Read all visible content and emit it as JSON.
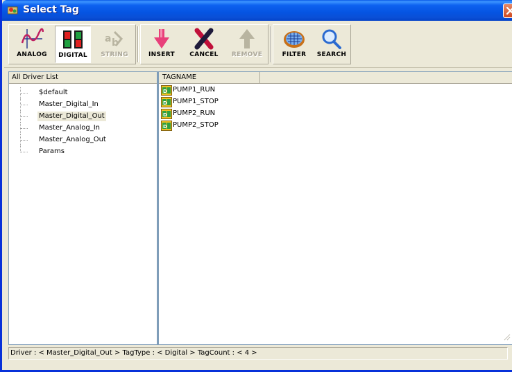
{
  "window": {
    "title": "Select Tag",
    "title_icon": "app-icon",
    "close_icon": "close-icon"
  },
  "toolbar": {
    "buttons": [
      {
        "label": "ANALOG",
        "icon": "analog-wave-icon",
        "state": "normal"
      },
      {
        "label": "DIGITAL",
        "icon": "digital-blocks-icon",
        "state": "active"
      },
      {
        "label": "STRING",
        "icon": "string-icon",
        "state": "disabled"
      },
      {
        "label": "INSERT",
        "icon": "insert-arrow-icon",
        "state": "normal"
      },
      {
        "label": "CANCEL",
        "icon": "cancel-x-icon",
        "state": "normal"
      },
      {
        "label": "REMOVE",
        "icon": "remove-arrow-icon",
        "state": "disabled"
      },
      {
        "label": "FILTER",
        "icon": "filter-icon",
        "state": "normal"
      },
      {
        "label": "SEARCH",
        "icon": "search-icon",
        "state": "normal"
      }
    ]
  },
  "driver_list": {
    "header": "All Driver List",
    "items": [
      {
        "label": "$default"
      },
      {
        "label": "Master_Digital_In"
      },
      {
        "label": "Master_Digital_Out",
        "selected": true
      },
      {
        "label": "Master_Analog_In"
      },
      {
        "label": "Master_Analog_Out"
      },
      {
        "label": "Params"
      }
    ]
  },
  "tag_list": {
    "column_header": "TAGNAME",
    "rows": [
      {
        "name": "PUMP1_RUN",
        "icon": "digital-tag-icon"
      },
      {
        "name": "PUMP1_STOP",
        "icon": "digital-tag-icon"
      },
      {
        "name": "PUMP2_RUN",
        "icon": "digital-tag-icon"
      },
      {
        "name": "PUMP2_STOP",
        "icon": "digital-tag-icon"
      }
    ]
  },
  "status": {
    "text": "Driver : < Master_Digital_Out >   TagType : < Digital >   TagCount : < 4 >"
  },
  "colors": {
    "titlebar": "#0554e2",
    "window_bg": "#ece9d8",
    "pane_border": "#7f9db9",
    "close_button": "#d0491f"
  }
}
